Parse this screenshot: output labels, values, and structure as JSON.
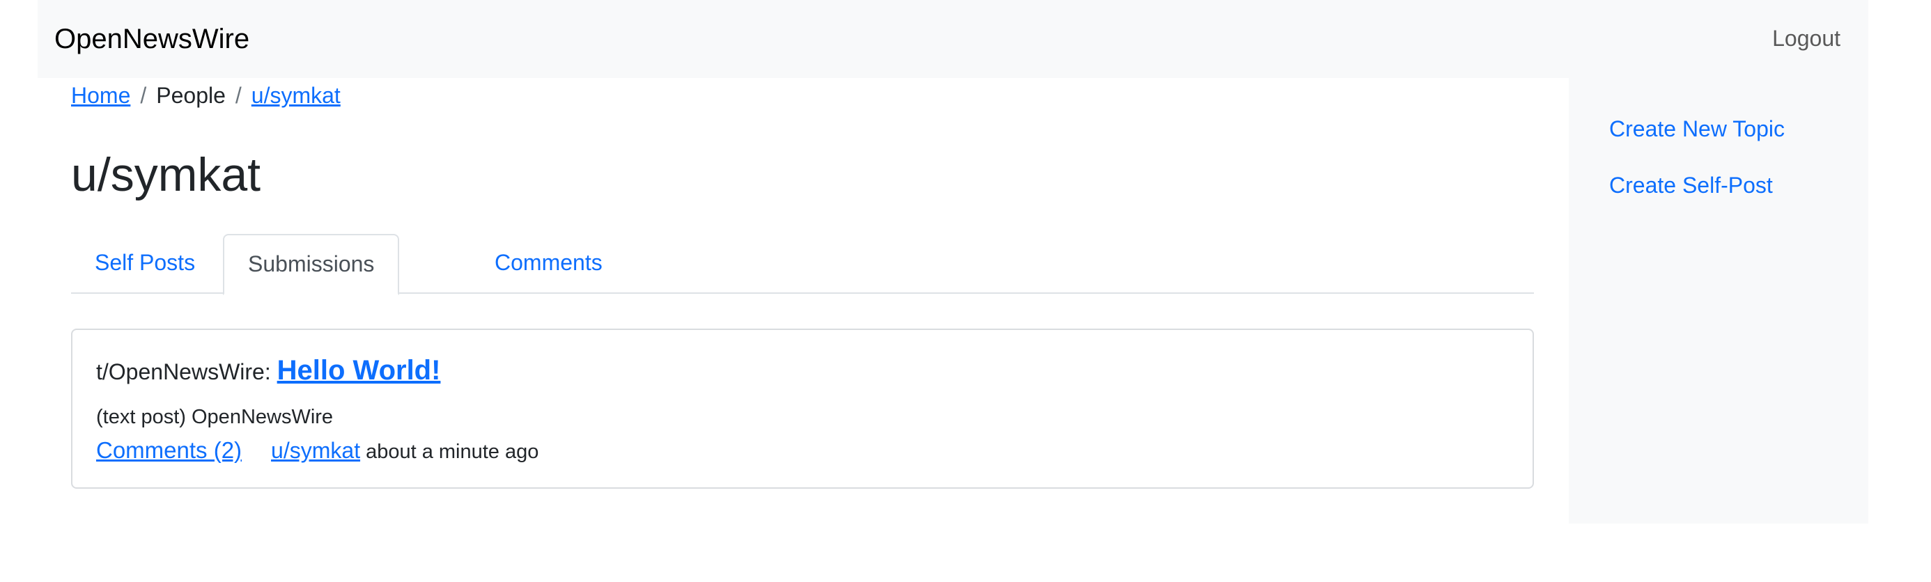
{
  "navbar": {
    "brand": "OpenNewsWire",
    "logout_label": "Logout"
  },
  "breadcrumb": {
    "home": "Home",
    "separator": "/",
    "people": "People",
    "user": "u/symkat"
  },
  "page": {
    "title": "u/symkat"
  },
  "tabs": [
    {
      "label": "Self Posts",
      "active": false
    },
    {
      "label": "Submissions",
      "active": true
    },
    {
      "label": "Comments",
      "active": false
    }
  ],
  "submission": {
    "topic": "t/OpenNewsWire:",
    "title": "Hello World!",
    "type": "(text post)",
    "source": "OpenNewsWire",
    "comments_label": "Comments (2)",
    "author": "u/symkat",
    "time": "about a minute ago"
  },
  "sidebar": {
    "items": [
      {
        "label": "Create New Topic"
      },
      {
        "label": "Create Self-Post"
      }
    ]
  },
  "colors": {
    "link": "#0d6efd",
    "navbar_bg": "#f8f9fa",
    "text": "#212529",
    "border": "#dee2e6"
  }
}
